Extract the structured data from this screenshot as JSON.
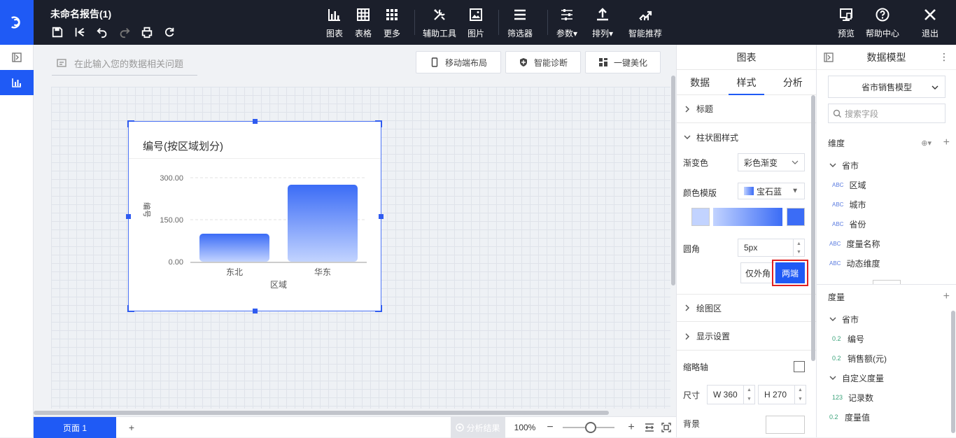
{
  "app": {
    "title": "未命名报告(1)"
  },
  "quick_icons": [
    "save-icon",
    "back-to-start-icon",
    "undo-icon",
    "redo-icon",
    "print-icon",
    "refresh-icon"
  ],
  "toolbar": {
    "chart": "图表",
    "table": "表格",
    "more": "更多",
    "assist": "辅助工具",
    "image": "图片",
    "filter": "筛选器",
    "params": "参数",
    "sort": "排列",
    "smart": "智能推荐",
    "preview": "预览",
    "help": "帮助中心",
    "exit": "退出"
  },
  "canvas": {
    "question_placeholder": "在此输入您的数据相关问题",
    "mobile_layout": "移动端布局",
    "smart_diagnosis": "智能诊断",
    "beautify": "一键美化"
  },
  "chart_data": {
    "type": "bar",
    "title": "编号(按区域划分)",
    "xlabel": "区域",
    "ylabel": "编号",
    "categories": [
      "东北",
      "华东"
    ],
    "values": [
      100,
      275
    ],
    "ylim": [
      0,
      300
    ],
    "yticks": [
      "0.00",
      "150.00",
      "300.00"
    ],
    "grid": true,
    "colors": {
      "top": "#3b6cf6",
      "bottom": "#c2d3ff"
    }
  },
  "bottom": {
    "page_tab": "页面 1",
    "add": "+",
    "analysis": "分析结果",
    "zoom": "100%"
  },
  "style_panel": {
    "header": "图表",
    "tabs": [
      "数据",
      "样式",
      "分析"
    ],
    "sections": {
      "title": "标题",
      "bar_style": "柱状图样式",
      "plot_area": "绘图区",
      "display": "显示设置"
    },
    "gradient_label": "渐变色",
    "gradient_value": "彩色渐变",
    "palette_label": "颜色模版",
    "palette_value": "宝石蓝",
    "radius_label": "圆角",
    "radius_value": "5px",
    "outer_only": "仅外角",
    "both_ends": "两端",
    "thumb_axis": "缩略轴",
    "size_label": "尺寸",
    "width": "W 360",
    "height": "H 270",
    "background": "背景"
  },
  "model_panel": {
    "header": "数据模型",
    "model": "省市销售模型",
    "search_placeholder": "搜索字段",
    "dimension_label": "维度",
    "dim_group": "省市",
    "dims": [
      {
        "type": "ABC",
        "name": "区域"
      },
      {
        "type": "ABC",
        "name": "城市"
      },
      {
        "type": "ABC",
        "name": "省份"
      },
      {
        "type": "ABC",
        "name": "度量名称"
      },
      {
        "type": "ABC",
        "name": "动态维度"
      }
    ],
    "measure_label": "度量",
    "measure_group": "省市",
    "measures": [
      {
        "type": "0.2",
        "name": "编号"
      },
      {
        "type": "0.2",
        "name": "销售额(元)"
      }
    ],
    "custom_group": "自定义度量",
    "custom_measures": [
      {
        "type": "123",
        "name": "记录数"
      },
      {
        "type": "0.2",
        "name": "度量值"
      }
    ]
  }
}
